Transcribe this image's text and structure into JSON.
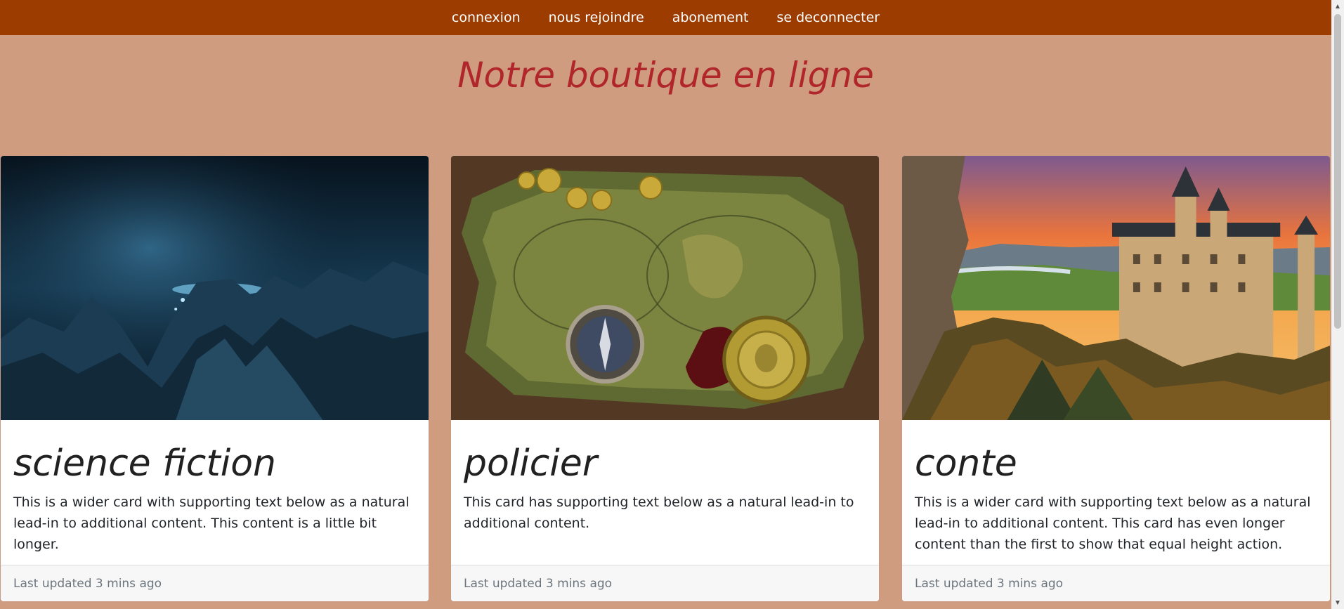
{
  "nav": {
    "items": [
      {
        "label": "connexion"
      },
      {
        "label": "nous rejoindre"
      },
      {
        "label": "abonement"
      },
      {
        "label": "se deconnecter"
      }
    ]
  },
  "page": {
    "title": "Notre boutique en ligne"
  },
  "cards": [
    {
      "title": "science fiction",
      "text": "This is a wider card with supporting text below as a natural lead-in to additional content. This content is a little bit longer.",
      "footer": "Last updated 3 mins ago",
      "image_icon": "sci-fi-landscape-image"
    },
    {
      "title": "policier",
      "text": "This card has supporting text below as a natural lead-in to additional content.",
      "footer": "Last updated 3 mins ago",
      "image_icon": "treasure-map-image"
    },
    {
      "title": "conte",
      "text": "This is a wider card with supporting text below as a natural lead-in to additional content. This card has even longer content than the first to show that equal height action.",
      "footer": "Last updated 3 mins ago",
      "image_icon": "castle-sunset-image"
    }
  ],
  "colors": {
    "navbar": "#9c3c00",
    "page_background": "#cf9c80",
    "title": "#b0262a",
    "card_background": "#ffffff",
    "footer_background": "#f7f7f7"
  }
}
